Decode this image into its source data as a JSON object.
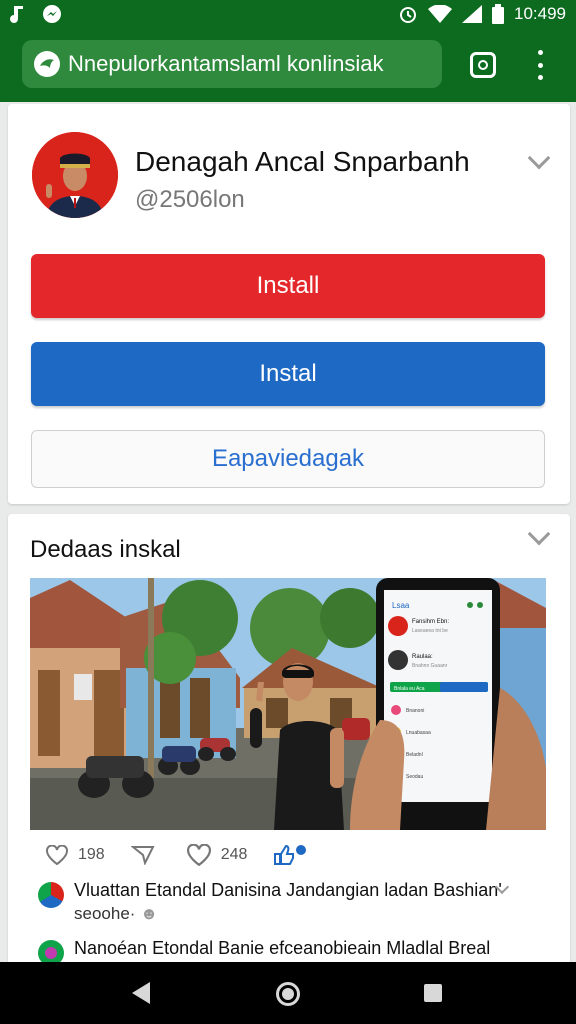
{
  "status_bar": {
    "time": "10:49",
    "battery": "9"
  },
  "browser": {
    "url": "Nnepulorkantamslaml konlinsiak"
  },
  "profile": {
    "name": "Denagah Ancal Snparbanh",
    "handle": "@2506lon",
    "buttons": {
      "primary": "Install",
      "secondary": "Instal",
      "outline": "Eapaviedagak"
    }
  },
  "feed": {
    "title": "Dedaas inskal",
    "stats": {
      "likes": "198",
      "reactions": "248"
    },
    "comments": [
      {
        "text": "Vluattan Etandal Danisina Jandangian ladan Bashian'",
        "sub": "seoohe·"
      },
      {
        "text": "Nanoéan Etondal Banie efceanobieain Mladlal Breal",
        "sub": ""
      }
    ]
  },
  "phone_mockup": {
    "header": "Lsaa",
    "rows": [
      {
        "name": "Fansihm Ebn:",
        "sub": "Laseaeea tnt be"
      },
      {
        "name": "Raulaa:",
        "sub": "Bnahnn Guaanr"
      }
    ],
    "cta": "Bnlala eu Aca",
    "list": [
      "Bnanoni",
      "Lnuabasaa",
      "Beladnl",
      "Seodau"
    ]
  },
  "colors": {
    "brand_green": "#0c6b1f",
    "install_red": "#e3272a",
    "install_blue": "#1e69c4",
    "link_blue": "#2a6fd0"
  }
}
